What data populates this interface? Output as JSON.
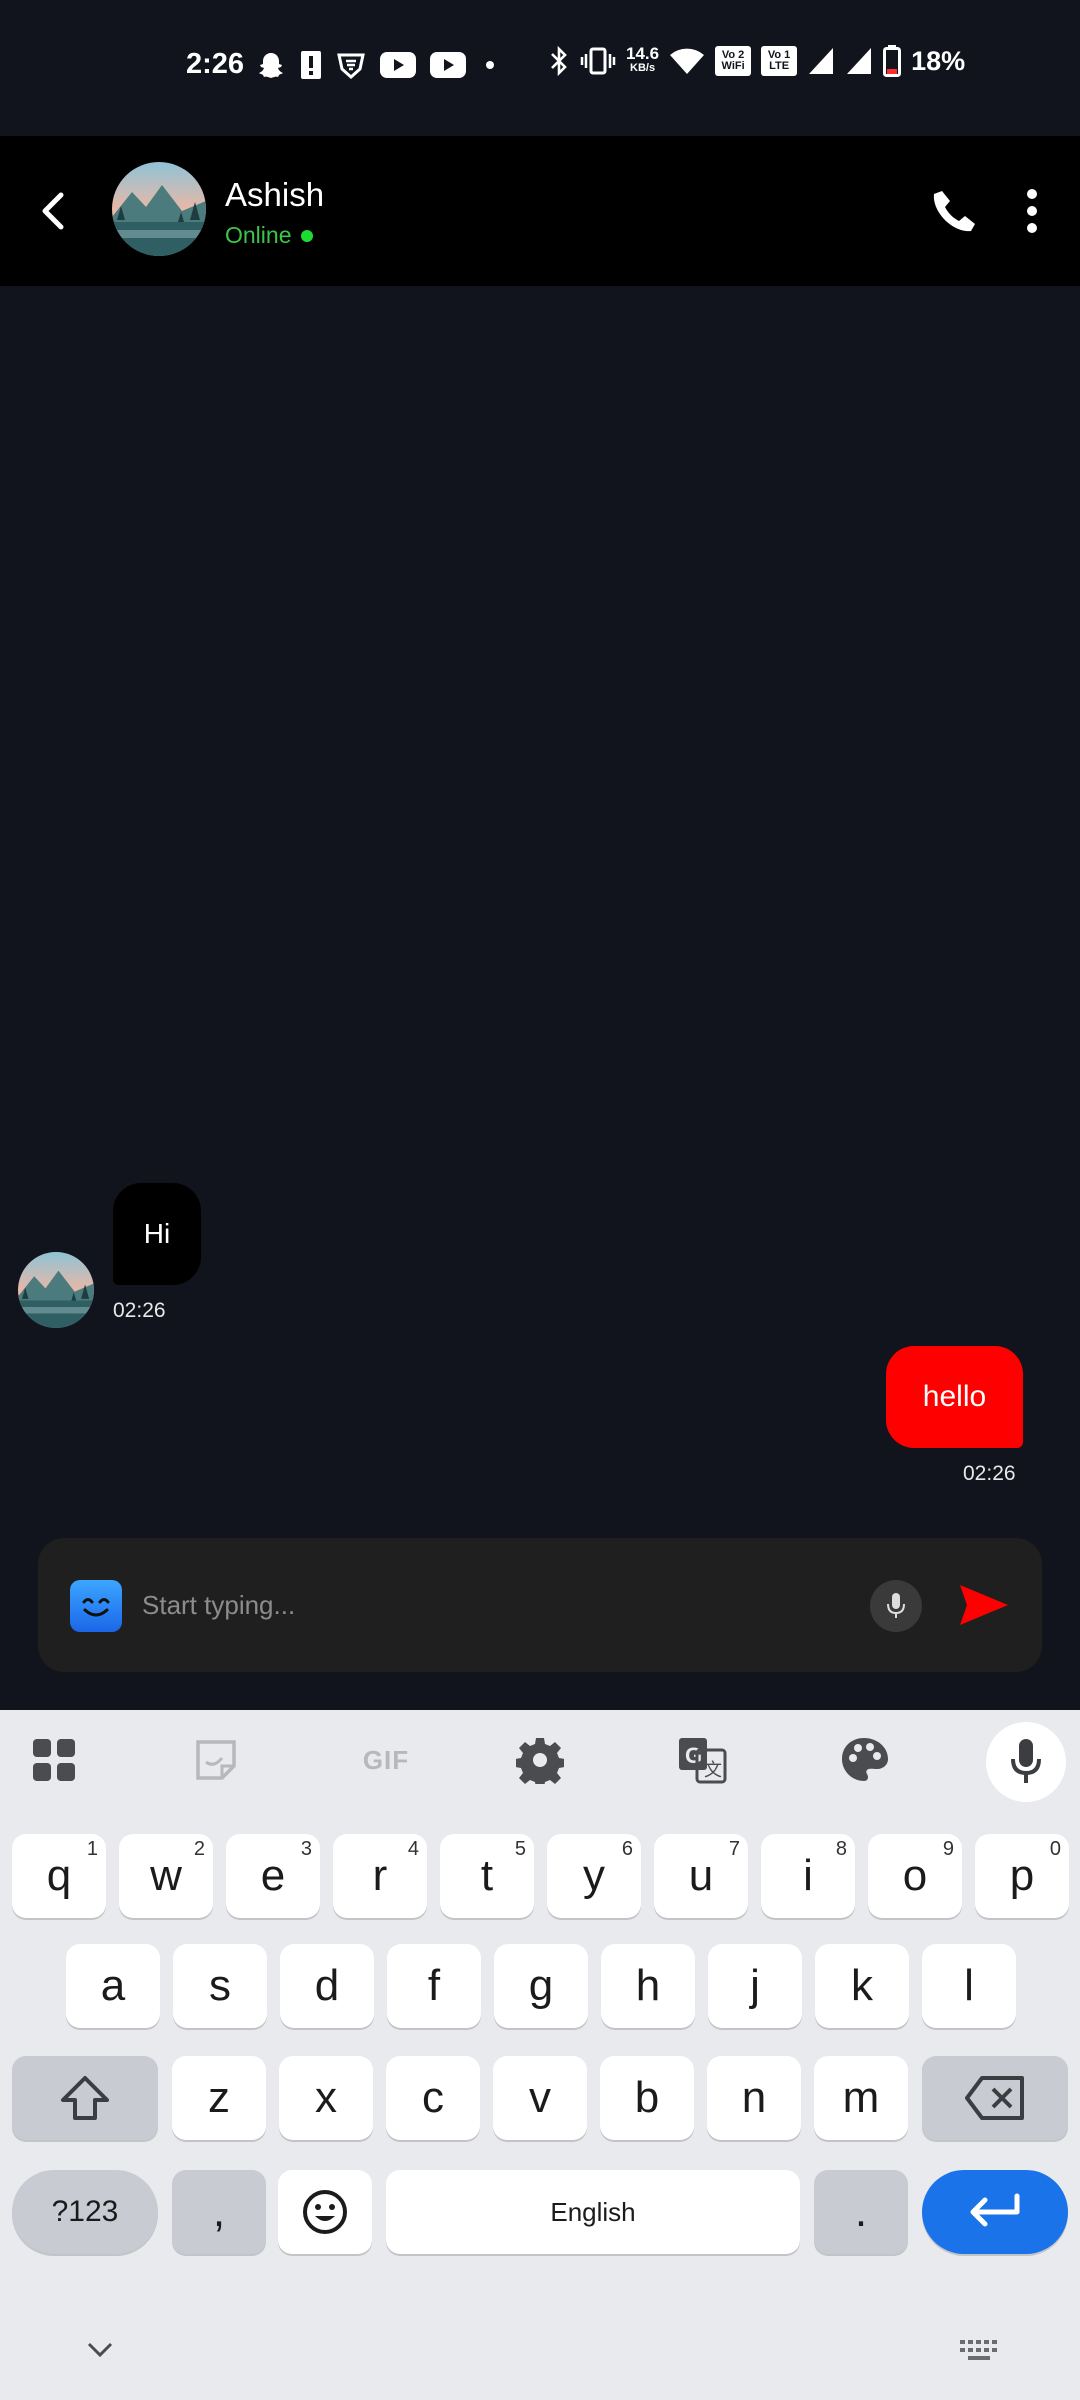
{
  "status_bar": {
    "time": "2:26",
    "net_speed_value": "14.6",
    "net_speed_unit": "KB/s",
    "vowifi_label": "Vo 2 WiFi",
    "volte_label": "Vo 1 LTE",
    "battery_percent": "18%"
  },
  "header": {
    "contact_name": "Ashish",
    "status": "Online"
  },
  "messages": [
    {
      "direction": "incoming",
      "text": "Hi",
      "time": "02:26"
    },
    {
      "direction": "outgoing",
      "text": "hello",
      "time": "02:26"
    }
  ],
  "composer": {
    "placeholder": "Start typing..."
  },
  "keyboard": {
    "toolbar": {
      "gif_label": "GIF"
    },
    "row1": [
      "q",
      "w",
      "e",
      "r",
      "t",
      "y",
      "u",
      "i",
      "o",
      "p"
    ],
    "row1_hints": [
      "1",
      "2",
      "3",
      "4",
      "5",
      "6",
      "7",
      "8",
      "9",
      "0"
    ],
    "row2": [
      "a",
      "s",
      "d",
      "f",
      "g",
      "h",
      "j",
      "k",
      "l"
    ],
    "row3": [
      "z",
      "x",
      "c",
      "v",
      "b",
      "n",
      "m"
    ],
    "symbols_label": "?123",
    "comma": ",",
    "space_label": "English",
    "period": "."
  },
  "colors": {
    "accent_red": "#fe0000",
    "online_green": "#1fdc33",
    "enter_blue": "#1a73e8"
  }
}
